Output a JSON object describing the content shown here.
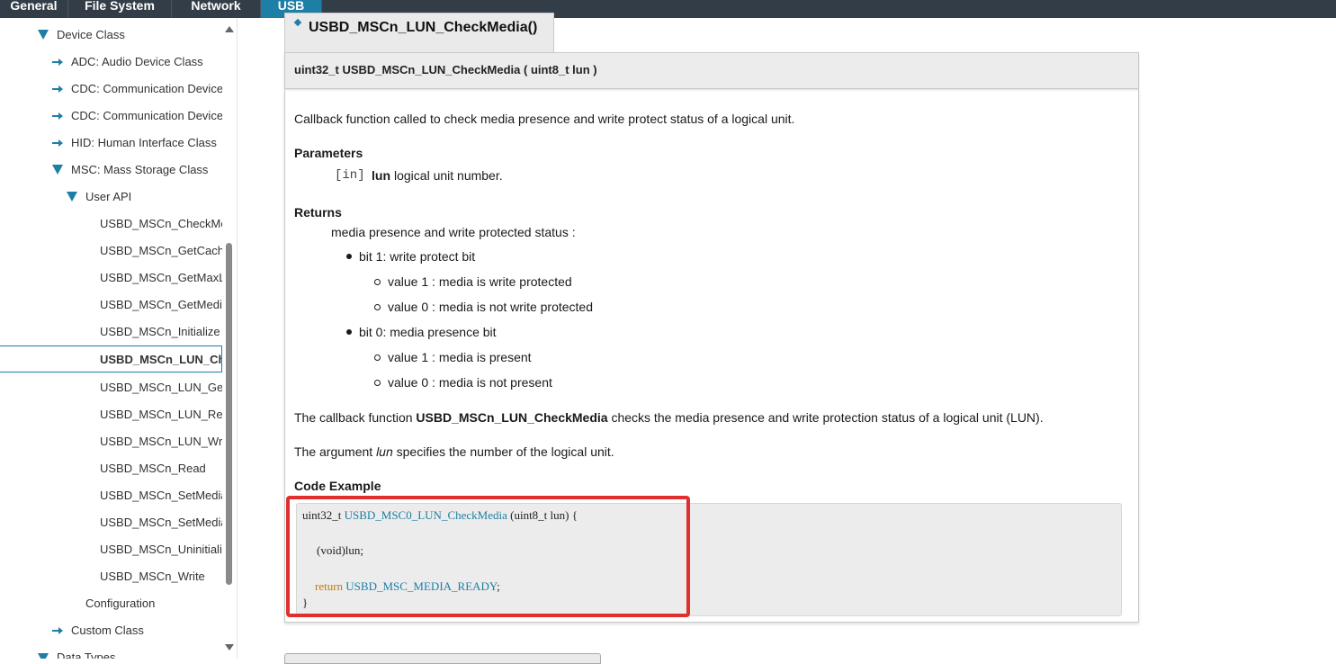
{
  "topnav": {
    "tabs": [
      {
        "label": "General"
      },
      {
        "label": "File System"
      },
      {
        "label": "Network"
      },
      {
        "label": "USB"
      }
    ],
    "active_tab": "USB"
  },
  "sidebar": {
    "items": [
      {
        "label": "Device Class",
        "state": "expanded"
      },
      {
        "label": "ADC: Audio Device Class",
        "state": "collapsed"
      },
      {
        "label": "CDC: Communication Device Class",
        "state": "collapsed"
      },
      {
        "label": "CDC: Communication Device Class",
        "state": "collapsed"
      },
      {
        "label": "HID: Human Interface Class",
        "state": "collapsed"
      },
      {
        "label": "MSC: Mass Storage Class",
        "state": "expanded"
      },
      {
        "label": "User API",
        "state": "expanded"
      },
      {
        "label": "USBD_MSCn_CheckMedia"
      },
      {
        "label": "USBD_MSCn_GetCacheInfo"
      },
      {
        "label": "USBD_MSCn_GetMaxLUN"
      },
      {
        "label": "USBD_MSCn_GetMediaCapacity"
      },
      {
        "label": "USBD_MSCn_Initialize"
      },
      {
        "label": "USBD_MSCn_LUN_CheckMedia",
        "active": true
      },
      {
        "label": "USBD_MSCn_LUN_GetMediaCapacity"
      },
      {
        "label": "USBD_MSCn_LUN_Read"
      },
      {
        "label": "USBD_MSCn_LUN_Write"
      },
      {
        "label": "USBD_MSCn_Read"
      },
      {
        "label": "USBD_MSCn_SetMediaOwnerFS"
      },
      {
        "label": "USBD_MSCn_SetMediaOwnerUSB"
      },
      {
        "label": "USBD_MSCn_Uninitialize"
      },
      {
        "label": "USBD_MSCn_Write"
      },
      {
        "label": "Configuration"
      },
      {
        "label": "Custom Class",
        "state": "collapsed"
      },
      {
        "label": "Data Types",
        "state": "expanded"
      }
    ]
  },
  "doc": {
    "title": "USBD_MSCn_LUN_CheckMedia()",
    "signature": "uint32_t USBD_MSCn_LUN_CheckMedia ( uint8_t  lun )",
    "description": "Callback function called to check media presence and write protect status of a logical unit.",
    "parameters_heading": "Parameters",
    "param_dir": "[in]",
    "param_name": "lun",
    "param_desc": "logical unit number.",
    "returns_heading": "Returns",
    "returns_text": "media presence and write protected status :",
    "bit1": "bit 1: write protect bit",
    "bit1_v1": "value 1 : media is write protected",
    "bit1_v0": "value 0 : media is not write protected",
    "bit0": "bit 0: media presence bit",
    "bit0_v1": "value 1 : media is present",
    "bit0_v0": "value 0 : media is not present",
    "callback_pre": "The callback function ",
    "callback_fn": "USBD_MSCn_LUN_CheckMedia",
    "callback_post": " checks the media presence and write protection status of a logical unit (LUN).",
    "argument_pre": "The argument ",
    "argument_name": "lun",
    "argument_post": " specifies the number of the logical unit.",
    "code_heading": "Code Example",
    "code": {
      "l1_type": "uint32_t ",
      "l1_fn": "USBD_MSC0_LUN_CheckMedia",
      "l1_rest": " (uint8_t lun) {",
      "l2": "(void)lun;",
      "l3_kw": "return",
      "l3_val": "USBD_MSC_MEDIA_READY",
      "l3_end": ";",
      "l4": "}"
    }
  },
  "colors": {
    "accent": "#1d7fa6",
    "topbar": "#333d47",
    "highlight": "#e0302d",
    "keyword": "#c77a00"
  }
}
